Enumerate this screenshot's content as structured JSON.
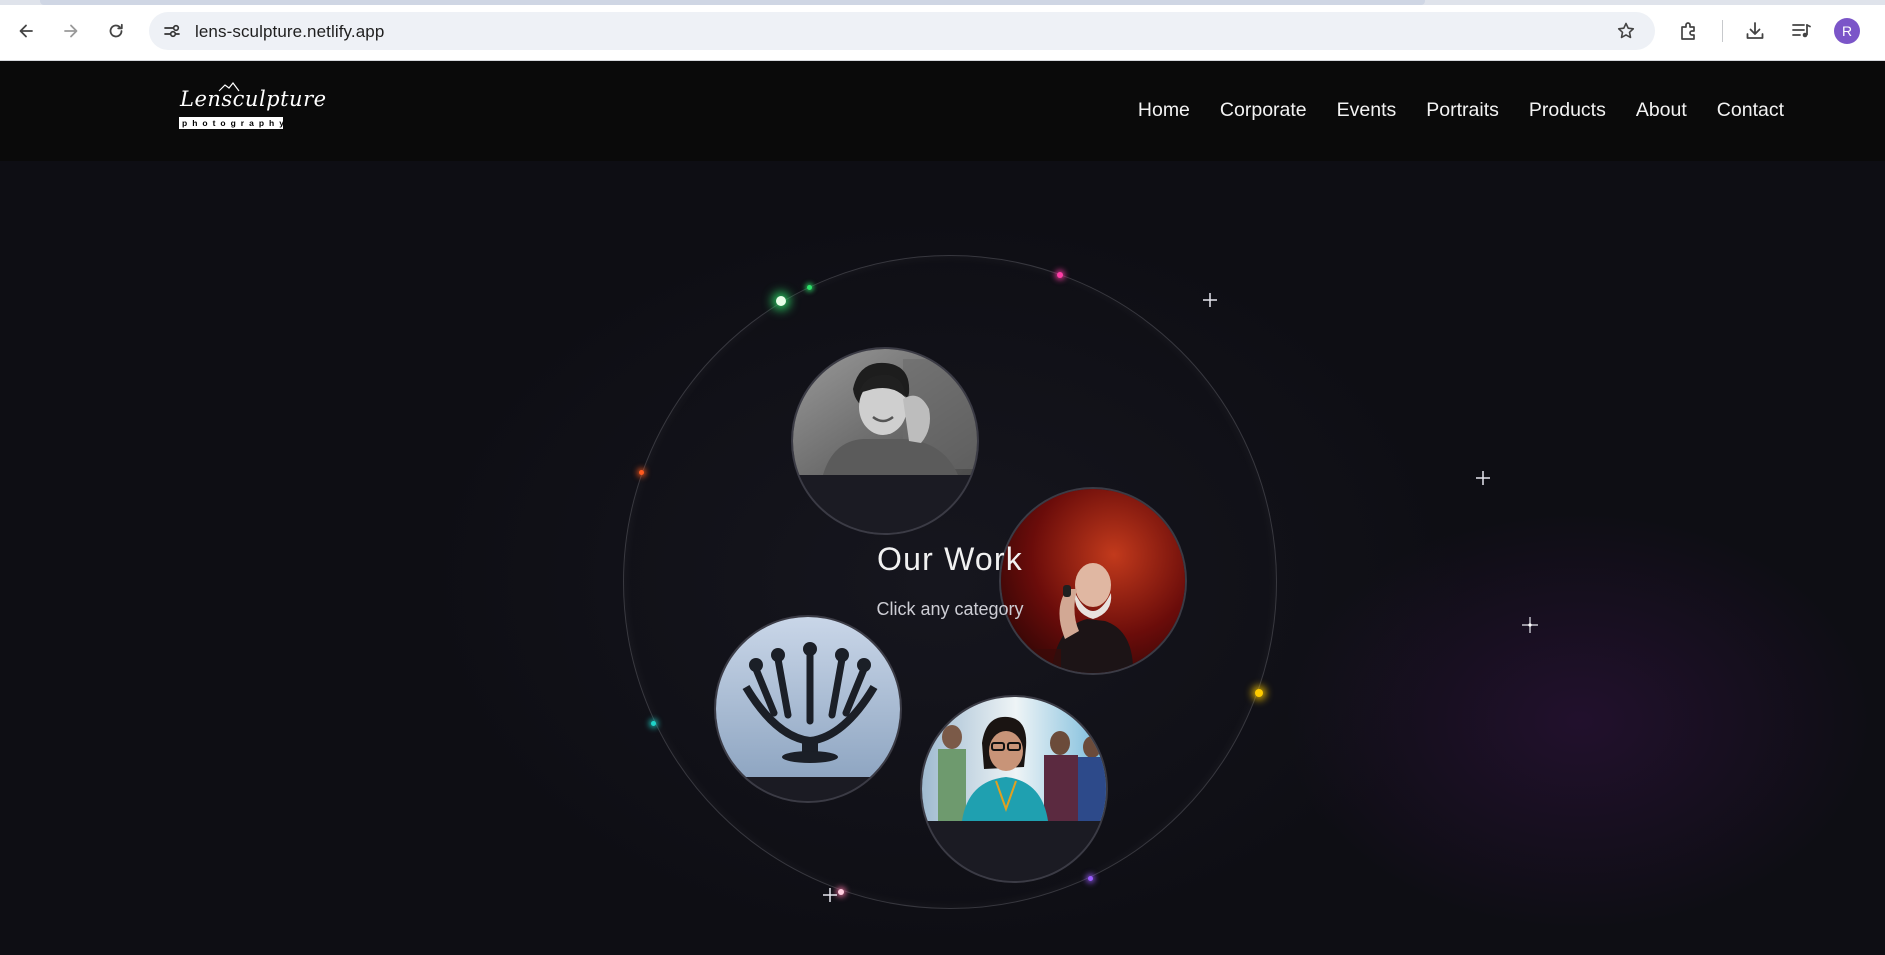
{
  "browser": {
    "url": "lens-sculpture.netlify.app",
    "profile_initial": "R",
    "icons": [
      "back-icon",
      "forward-icon",
      "reload-icon",
      "site-info-icon",
      "bookmark-star-icon",
      "extensions-icon",
      "downloads-icon",
      "media-controls-icon"
    ]
  },
  "site": {
    "logo": {
      "script": "Lensculpture",
      "sub": "photography"
    },
    "nav": [
      "Home",
      "Corporate",
      "Events",
      "Portraits",
      "Products",
      "About",
      "Contact"
    ],
    "hero": {
      "title": "Our Work",
      "subtitle": "Click any category"
    },
    "categories": [
      "portraits-circle",
      "events-circle",
      "products-circle",
      "corporate-circle"
    ],
    "colors": {
      "background": "#0d0d12",
      "header": "#0a0a0a",
      "accent_green": "#2ee26a",
      "accent_pink": "#ff3da6",
      "accent_yellow": "#ffcc00",
      "accent_orange": "#ff5a1f",
      "accent_teal": "#1fd3c8",
      "accent_purple": "#9a5cff"
    }
  }
}
